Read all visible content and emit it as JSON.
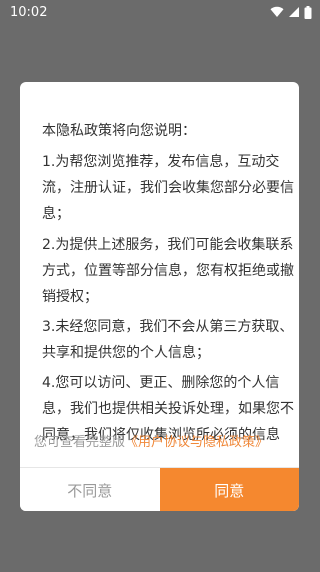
{
  "status_bar": {
    "time": "10:02"
  },
  "dialog": {
    "paragraphs": [
      {
        "lines": [
          "本隐私政策将向您说明："
        ]
      },
      {
        "lines": [
          "1.为帮您浏览推荐，发布信息，互动交",
          "流，注册认证，我们会收集您部分必要信",
          "息；"
        ]
      },
      {
        "lines": [
          "2.为提供上述服务，我们可能会收集联系",
          "方式，位置等部分信息，您有权拒绝或撤",
          "销授权；"
        ]
      },
      {
        "lines": [
          "3.未经您同意，我们不会从第三方获取、",
          "共享和提供您的个人信息；"
        ]
      },
      {
        "lines": [
          "4.您可以访问、更正、删除您的个人信",
          "息，我们也提供相关投诉处理，如果您不",
          "同意，我们将仅收集浏览所必须的信息"
        ]
      }
    ],
    "link_prefix": "您可查看完整版",
    "link_text": "《用户协议与隐私政策》",
    "disagree_label": "不同意",
    "agree_label": "同意"
  },
  "colors": {
    "accent": "#f5882f",
    "link": "#f0893b",
    "overlay": "#6b6b6b"
  },
  "icons": [
    "wifi-icon",
    "signal-icon",
    "battery-icon"
  ]
}
